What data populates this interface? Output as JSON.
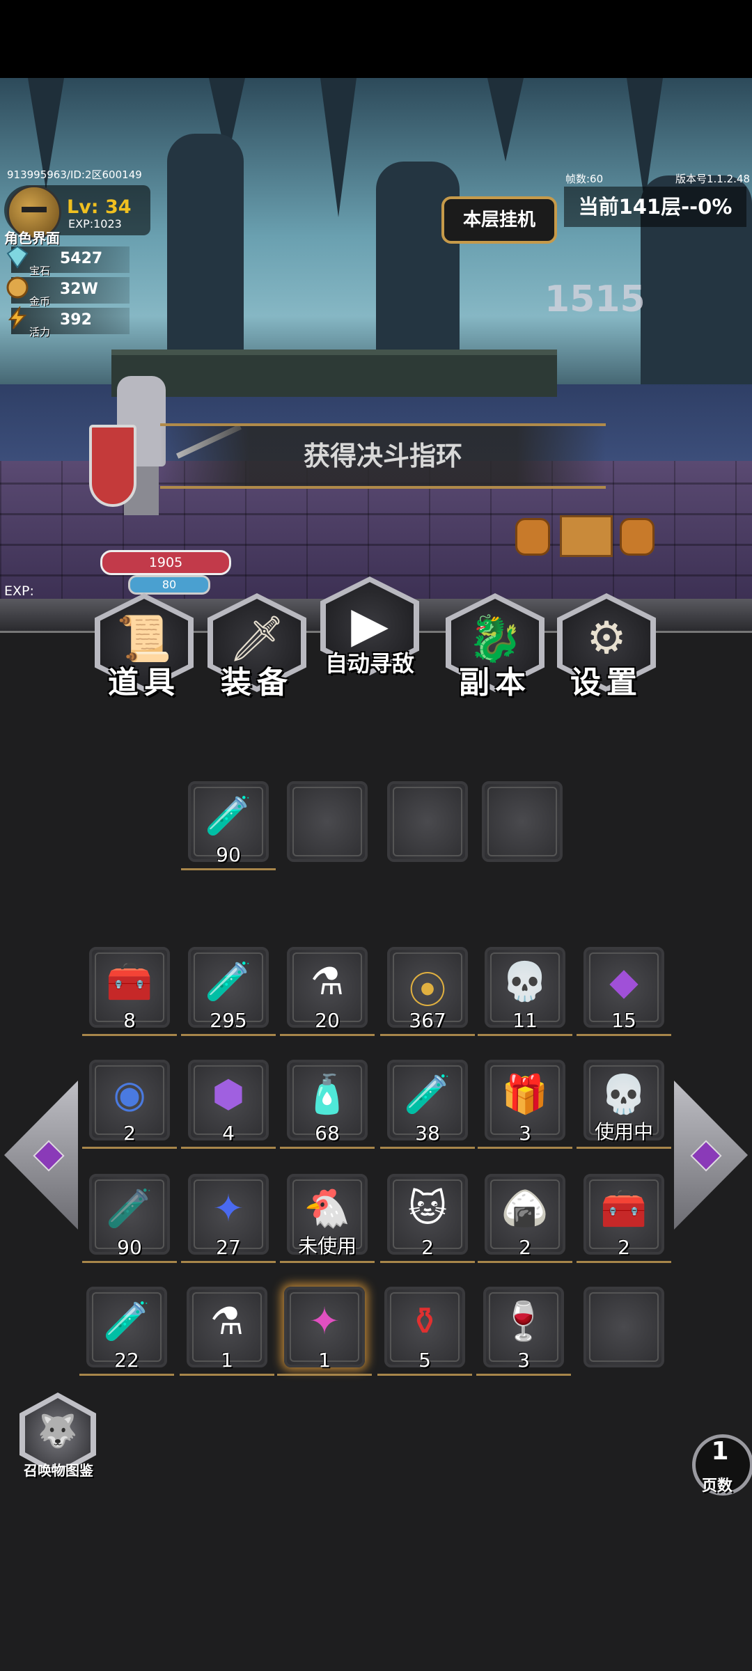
{
  "hud": {
    "player_id": "913995963/ID:2区600149",
    "fps": "帧数:60",
    "version": "版本号1.1.2.48",
    "level": "Lv: 34",
    "exp": "EXP:1023",
    "role_label": "角色界面",
    "stats": [
      {
        "label": "宝石",
        "value": "5427",
        "icon": "gem-icon"
      },
      {
        "label": "金币",
        "value": "32W",
        "icon": "coin-icon"
      },
      {
        "label": "活力",
        "value": "392",
        "icon": "lightning-icon"
      }
    ],
    "afk_button": "本层挂机",
    "floor_status": "当前141层--0%",
    "damage_number": "1515"
  },
  "battle": {
    "banner": "获得决斗指环",
    "hp": "1905",
    "mp": "80",
    "exp_label": "EXP:"
  },
  "menu": [
    {
      "label": "道具",
      "icon": "scroll-icon"
    },
    {
      "label": "装备",
      "icon": "sword-icon"
    },
    {
      "label": "自动寻敌",
      "icon": "play-icon"
    },
    {
      "label": "副本",
      "icon": "dragon-icon"
    },
    {
      "label": "设置",
      "icon": "gears-icon"
    }
  ],
  "quick_slots": [
    {
      "item": "red-potion",
      "count": "90"
    },
    {
      "item": "empty",
      "count": ""
    },
    {
      "item": "empty",
      "count": ""
    },
    {
      "item": "empty",
      "count": ""
    }
  ],
  "inventory": [
    {
      "item": "golden-chest",
      "count": "8"
    },
    {
      "item": "blue-vial",
      "count": "295"
    },
    {
      "item": "cyan-flask",
      "count": "20"
    },
    {
      "item": "gold-coin",
      "count": "367"
    },
    {
      "item": "skull-chest",
      "count": "11"
    },
    {
      "item": "purple-crystal",
      "count": "15"
    },
    {
      "item": "blue-orb",
      "count": "2"
    },
    {
      "item": "purple-gem",
      "count": "4"
    },
    {
      "item": "blue-potion",
      "count": "68"
    },
    {
      "item": "blue-tube",
      "count": "38"
    },
    {
      "item": "purple-chest",
      "count": "3"
    },
    {
      "item": "skeleton",
      "count": "使用中"
    },
    {
      "item": "red-vial-faded",
      "count": "90"
    },
    {
      "item": "blue-amulet",
      "count": "27"
    },
    {
      "item": "chicken",
      "count": "未使用"
    },
    {
      "item": "caged-cat",
      "count": "2"
    },
    {
      "item": "rice-dumpling",
      "count": "2"
    },
    {
      "item": "silver-chest",
      "count": "2"
    },
    {
      "item": "red-tube",
      "count": "22"
    },
    {
      "item": "yellow-flask",
      "count": "1"
    },
    {
      "item": "pink-amulet",
      "count": "1"
    },
    {
      "item": "red-flask",
      "count": "5"
    },
    {
      "item": "red-elixir",
      "count": "3"
    },
    {
      "item": "empty",
      "count": ""
    }
  ],
  "summon_label": "召唤物图鉴",
  "page": {
    "number": "1",
    "label": "页数"
  }
}
